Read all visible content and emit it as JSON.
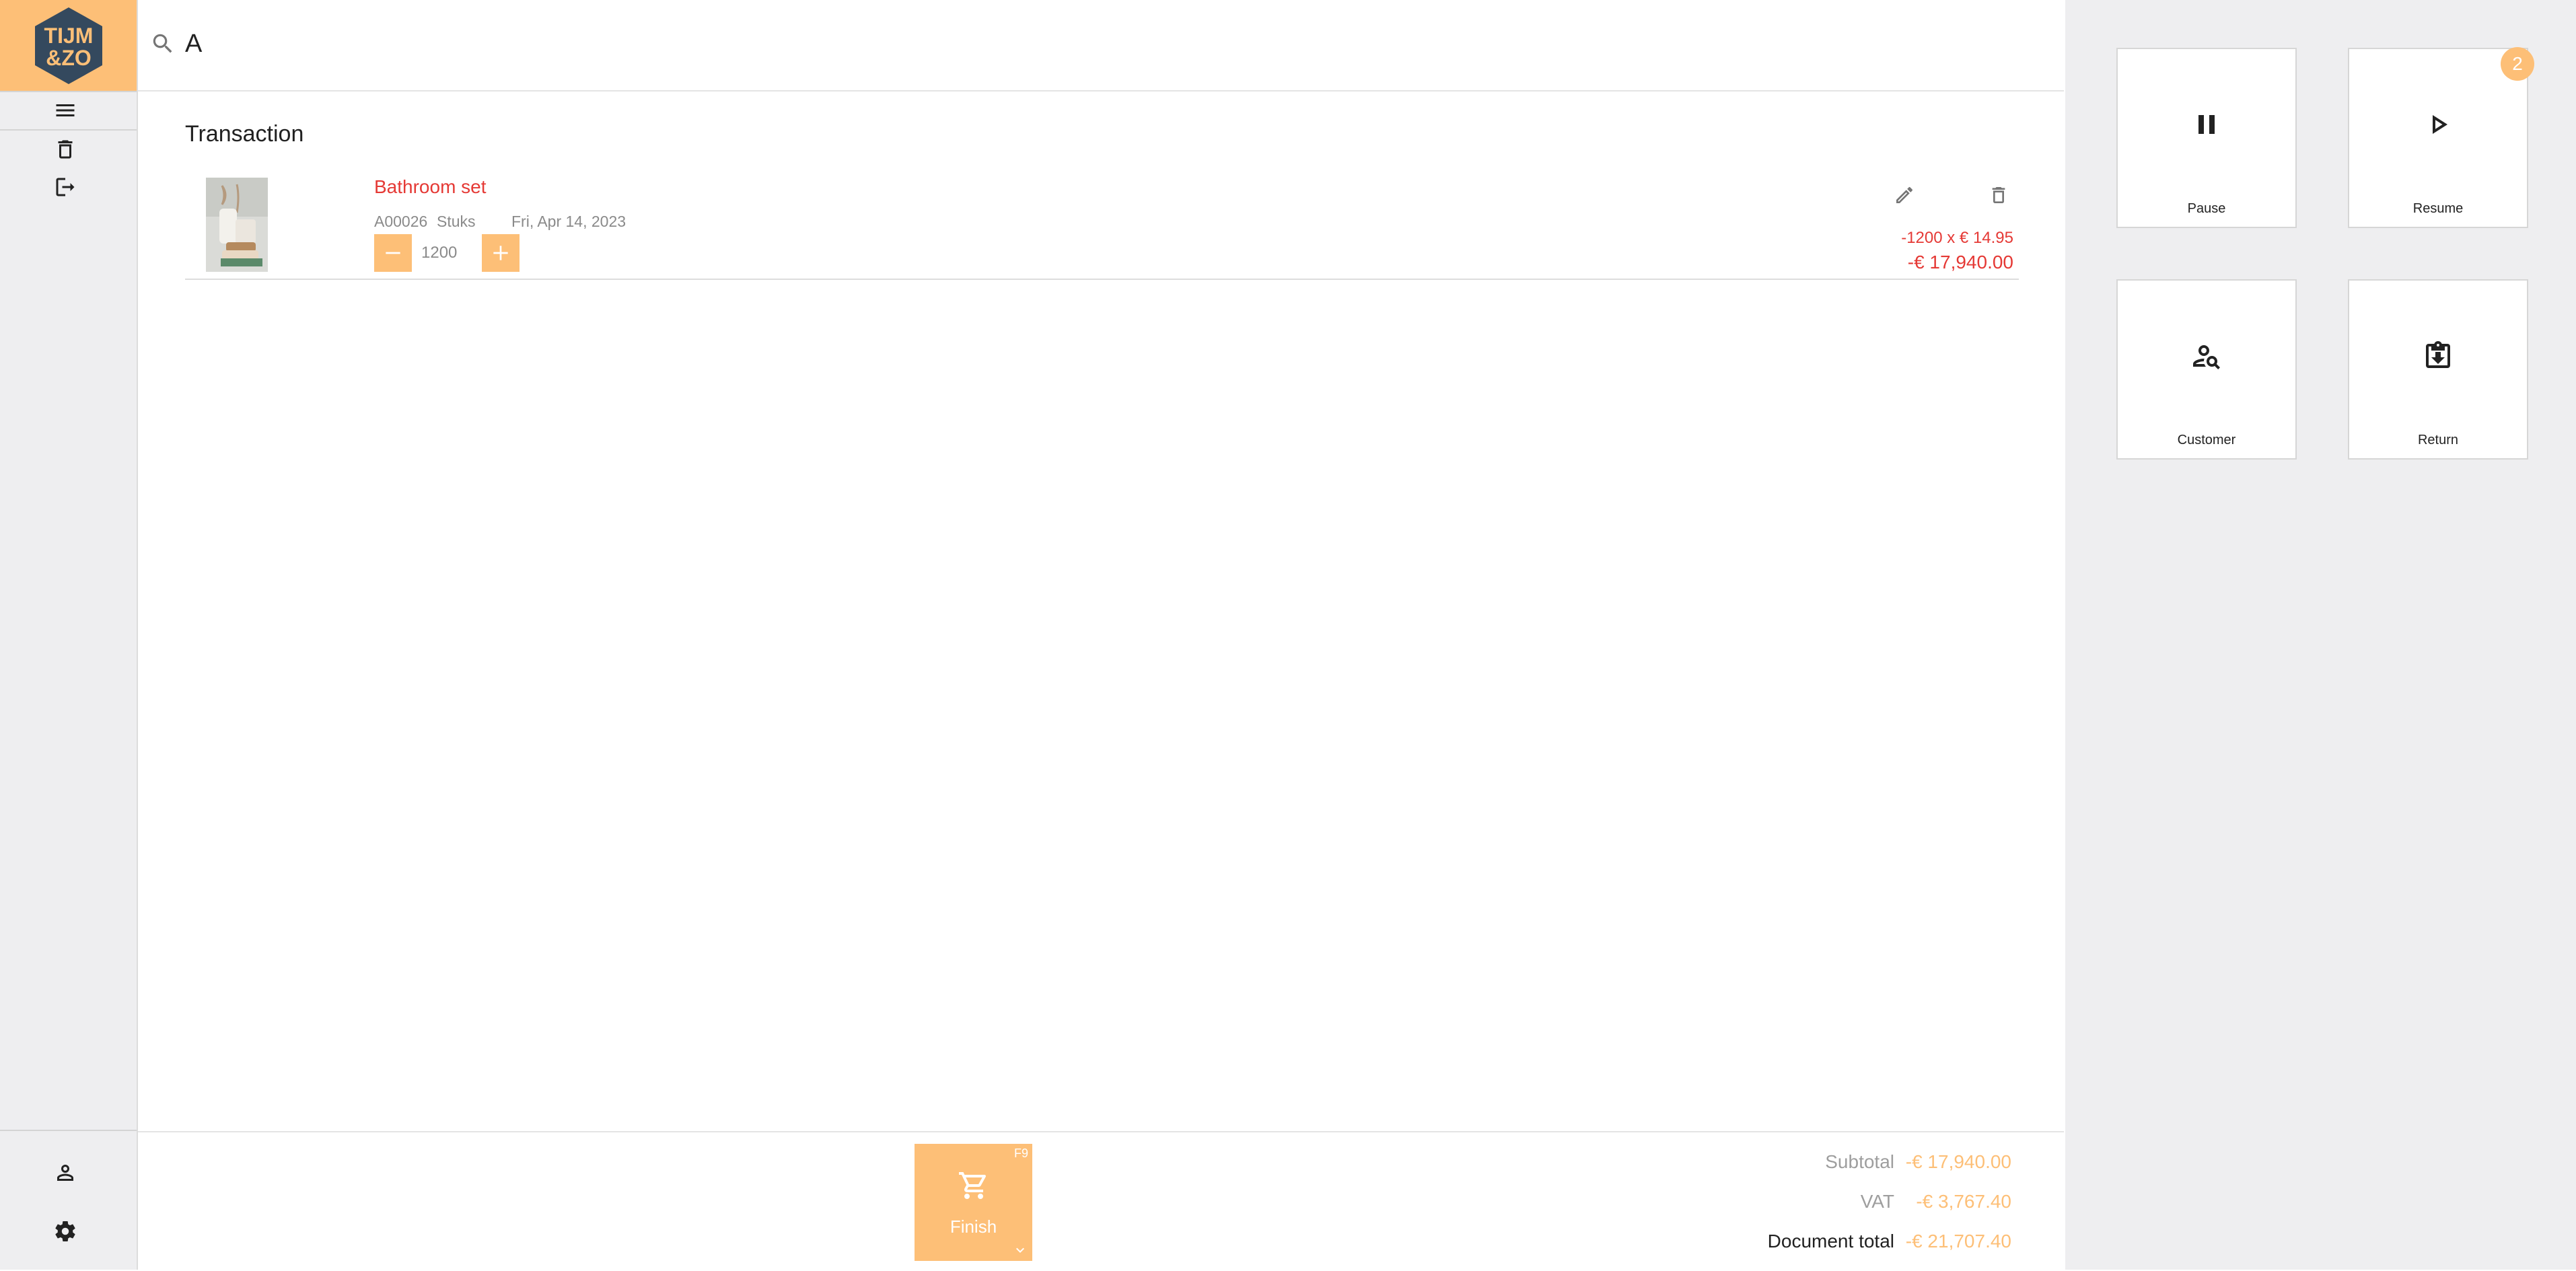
{
  "brand": {
    "logo_text_line1": "TIJM",
    "logo_text_line2": "&ZO",
    "accent_color": "#fdbf77",
    "hex_color": "#34495e"
  },
  "sidebar": {
    "top_items": [
      {
        "icon": "menu-icon"
      },
      {
        "icon": "trash-icon"
      },
      {
        "icon": "logout-icon"
      }
    ],
    "bottom_items": [
      {
        "icon": "person-icon"
      },
      {
        "icon": "gear-icon"
      }
    ]
  },
  "search": {
    "value": "A",
    "icon": "search-icon",
    "camera_icon": "camera-icon"
  },
  "transaction": {
    "title": "Transaction",
    "items": [
      {
        "name": "Bathroom set",
        "code": "A00026",
        "unit": "Stuks",
        "date": "Fri, Apr 14, 2023",
        "quantity": "1200",
        "price_line": "-1200 x € 14.95",
        "line_total": "-€ 17,940.00"
      }
    ]
  },
  "footer": {
    "finish": {
      "label": "Finish",
      "shortcut": "F9"
    },
    "subtotal_label": "Subtotal",
    "subtotal_value": "-€ 17,940.00",
    "vat_label": "VAT",
    "vat_value": "-€ 3,767.40",
    "total_label": "Document total",
    "total_value": "-€ 21,707.40"
  },
  "actions": {
    "pause_label": "Pause",
    "resume_label": "Resume",
    "resume_badge": "2",
    "customer_label": "Customer",
    "return_label": "Return"
  }
}
